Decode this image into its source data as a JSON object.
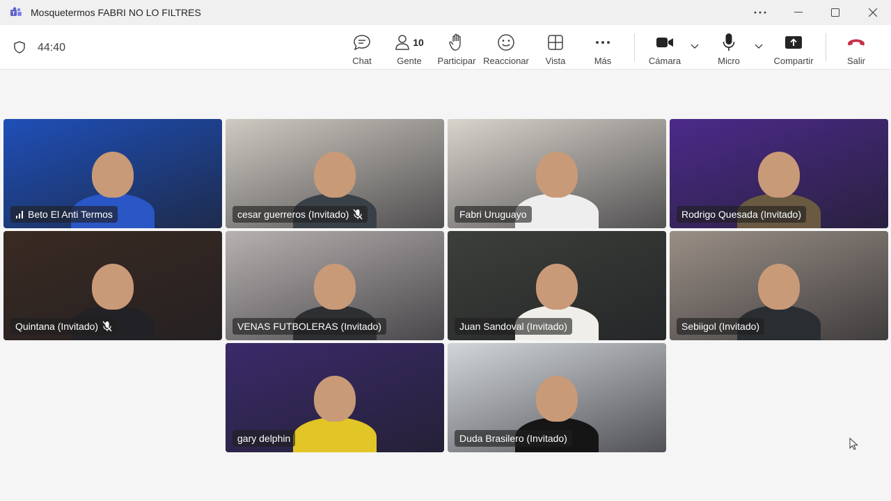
{
  "window": {
    "title": "Mosquetermos FABRI NO LO FILTRES",
    "more_icon": "more-horizontal-icon",
    "minimize_icon": "minimize-icon",
    "maximize_icon": "maximize-icon",
    "close_icon": "close-icon"
  },
  "toolbar": {
    "timer": "44:40",
    "chat": "Chat",
    "people": "Gente",
    "people_count": "10",
    "raise": "Participar",
    "react": "Reaccionar",
    "view": "Vista",
    "more": "Más",
    "camera": "Cámara",
    "mic": "Micro",
    "share": "Compartir",
    "leave": "Salir"
  },
  "colors": {
    "accent": "#6b6ccf",
    "leave": "#c4314b",
    "nameplate": "#1e1e1e"
  },
  "participants": [
    {
      "name": "Beto El Anti Termos",
      "bg": "#1f4fb8",
      "shirt": "#2a56c6",
      "speaking": false,
      "muted": false,
      "signal": true
    },
    {
      "name": "cesar guerreros (Invitado)",
      "bg": "#cfcac2",
      "shirt": "#3a4048",
      "speaking": false,
      "muted": true,
      "signal": false
    },
    {
      "name": "Fabri Uruguayo",
      "bg": "#d9d4cc",
      "shirt": "#eeeeee",
      "speaking": true,
      "muted": false,
      "signal": false
    },
    {
      "name": "Rodrigo Quesada (Invitado)",
      "bg": "#4b2a8a",
      "shirt": "#6a5a42",
      "speaking": true,
      "muted": false,
      "signal": false
    },
    {
      "name": "Quintana (Invitado)",
      "bg": "#3a2a22",
      "shirt": "#222226",
      "speaking": false,
      "muted": true,
      "signal": false
    },
    {
      "name": "VENAS FUTBOLERAS (Invitado)",
      "bg": "#b7b1b0",
      "shirt": "#2d2f33",
      "speaking": false,
      "muted": false,
      "signal": false
    },
    {
      "name": "Juan Sandoval (Invitado)",
      "bg": "#3c3f3a",
      "shirt": "#f0eee8",
      "speaking": true,
      "muted": false,
      "signal": false
    },
    {
      "name": "Sebiigol (Invitado)",
      "bg": "#9a8f86",
      "shirt": "#2a2e33",
      "speaking": false,
      "muted": false,
      "signal": false
    },
    {
      "name": "gary delphin",
      "bg": "#3a2a6a",
      "shirt": "#e2c526",
      "speaking": true,
      "muted": false,
      "signal": false
    },
    {
      "name": "Duda Brasilero (Invitado)",
      "bg": "#d2d6da",
      "shirt": "#151515",
      "speaking": false,
      "muted": false,
      "signal": false
    }
  ]
}
